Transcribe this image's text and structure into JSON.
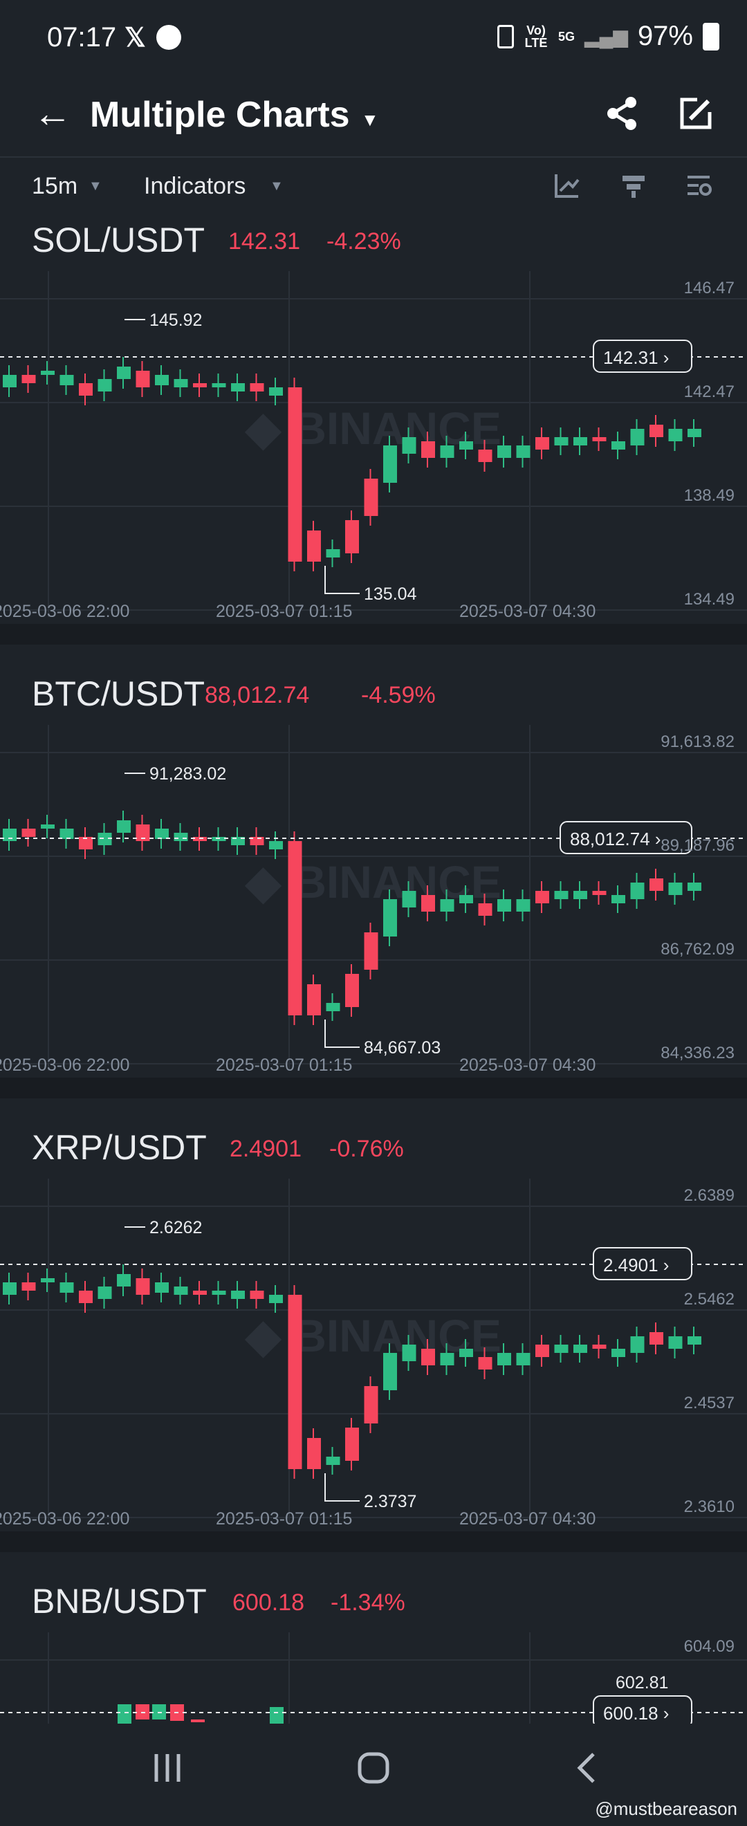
{
  "status_bar": {
    "time": "07:17",
    "network_label_top": "Vo) LTE",
    "network_label_5g": "5G",
    "battery_percent": "97%"
  },
  "app_bar": {
    "title": "Multiple Charts",
    "icons": [
      "back-arrow-icon",
      "share-icon",
      "edit-icon"
    ]
  },
  "toolbar": {
    "interval": "15m",
    "indicators": "Indicators"
  },
  "watermark": "BINANCE",
  "credit": "@mustbeareason",
  "colors": {
    "up": "#2ebd85",
    "down": "#f6465d",
    "bg": "#1e2329",
    "grid": "#2b3139",
    "axis_text": "#848e9c"
  },
  "charts": [
    {
      "pair": "SOL/USDT",
      "price": "142.31",
      "change": "-4.23%",
      "current_label": "142.31",
      "y_labels": [
        "146.47",
        "142.47",
        "138.49",
        "134.49"
      ],
      "x_labels": [
        "2025-03-06 22:00",
        "2025-03-07 01:15",
        "2025-03-07 04:30"
      ],
      "high_label": "145.92",
      "low_label": "135.04"
    },
    {
      "pair": "BTC/USDT",
      "price": "88,012.74",
      "change": "-4.59%",
      "current_label": "88,012.74",
      "y_labels": [
        "91,613.82",
        "89,187.96",
        "86,762.09",
        "84,336.23"
      ],
      "x_labels": [
        "2025-03-06 22:00",
        "2025-03-07 01:15",
        "2025-03-07 04:30"
      ],
      "high_label": "91,283.02",
      "low_label": "84,667.03"
    },
    {
      "pair": "XRP/USDT",
      "price": "2.4901",
      "change": "-0.76%",
      "current_label": "2.4901",
      "y_labels": [
        "2.6389",
        "2.5462",
        "2.4537",
        "2.3610"
      ],
      "x_labels": [
        "2025-03-06 22:00",
        "2025-03-07 01:15",
        "2025-03-07 04:30"
      ],
      "high_label": "2.6262",
      "low_label": "2.3737"
    },
    {
      "pair": "BNB/USDT",
      "price": "600.18",
      "change": "-1.34%",
      "current_label": "600.18",
      "y_labels": [
        "604.09"
      ],
      "x_labels": [],
      "high_label": "602.81",
      "low_label": ""
    }
  ]
}
